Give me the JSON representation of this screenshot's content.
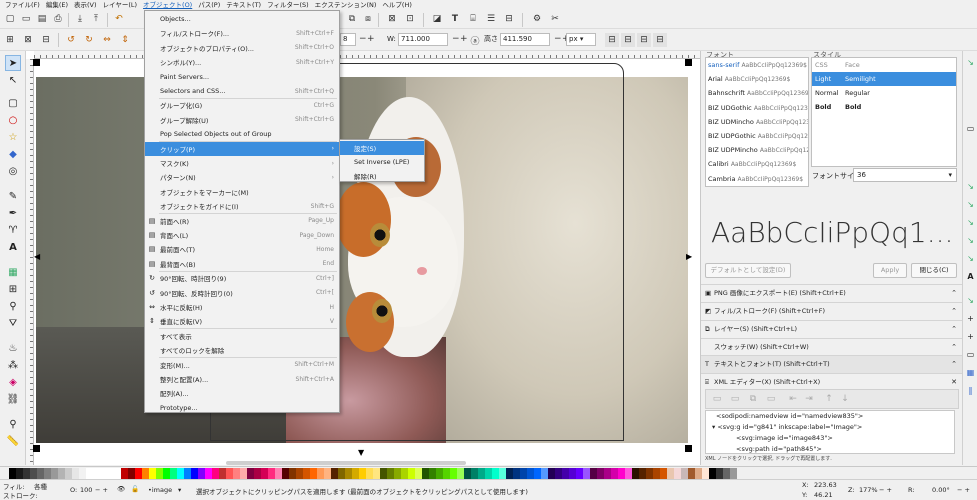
{
  "menubar": [
    "ファイル(F)",
    "編集(E)",
    "表示(V)",
    "レイヤー(L)",
    "オブジェクト(O)",
    "パス(P)",
    "テキスト(T)",
    "フィルター(S)",
    "エクステンション(N)",
    "ヘルプ(H)"
  ],
  "active_menu_index": 4,
  "controls": {
    "x_value": "8",
    "w_label": "W:",
    "w_value": "711.000",
    "h_label": "高さ",
    "h_value": "411.590",
    "unit": "px"
  },
  "object_menu": [
    {
      "label": "Objects...",
      "shortcut": "",
      "icon": ""
    },
    {
      "label": "フィル/ストローク(F)...",
      "shortcut": "Shift+Ctrl+F",
      "icon": ""
    },
    {
      "label": "オブジェクトのプロパティ(O)...",
      "shortcut": "Shift+Ctrl+O",
      "icon": ""
    },
    {
      "label": "シンボル(Y)...",
      "shortcut": "Shift+Ctrl+Y",
      "icon": ""
    },
    {
      "label": "Paint Servers...",
      "shortcut": "",
      "icon": ""
    },
    {
      "label": "Selectors and CSS...",
      "shortcut": "Shift+Ctrl+Q",
      "icon": ""
    },
    {
      "label": "グループ化(G)",
      "shortcut": "Ctrl+G",
      "icon": ""
    },
    {
      "label": "グループ解除(U)",
      "shortcut": "Shift+Ctrl+G",
      "icon": ""
    },
    {
      "label": "Pop Selected Objects out of Group",
      "shortcut": "",
      "icon": ""
    },
    {
      "label": "クリップ(P)",
      "shortcut": "›",
      "icon": ""
    },
    {
      "label": "マスク(K)",
      "shortcut": "›",
      "icon": ""
    },
    {
      "label": "パターン(N)",
      "shortcut": "›",
      "icon": ""
    },
    {
      "label": "オブジェクトをマーカーに(M)",
      "shortcut": "",
      "icon": ""
    },
    {
      "label": "オブジェクトをガイドに(I)",
      "shortcut": "Shift+G",
      "icon": ""
    },
    {
      "label": "前面へ(R)",
      "shortcut": "Page_Up",
      "icon": "▤"
    },
    {
      "label": "背面へ(L)",
      "shortcut": "Page_Down",
      "icon": "▤"
    },
    {
      "label": "最前面へ(T)",
      "shortcut": "Home",
      "icon": "▤"
    },
    {
      "label": "最背面へ(B)",
      "shortcut": "End",
      "icon": "▤"
    },
    {
      "label": "90°回転、時計回り(9)",
      "shortcut": "Ctrl+]",
      "icon": "↻"
    },
    {
      "label": "90°回転、反時計回り(0)",
      "shortcut": "Ctrl+[",
      "icon": "↺"
    },
    {
      "label": "水平に反転(H)",
      "shortcut": "H",
      "icon": "⇔"
    },
    {
      "label": "垂直に反転(V)",
      "shortcut": "V",
      "icon": "⇕"
    },
    {
      "label": "すべて表示",
      "shortcut": "",
      "icon": ""
    },
    {
      "label": "すべてのロックを解除",
      "shortcut": "",
      "icon": ""
    },
    {
      "label": "変形(M)...",
      "shortcut": "Shift+Ctrl+M",
      "icon": ""
    },
    {
      "label": "整列と配置(A)...",
      "shortcut": "Shift+Ctrl+A",
      "icon": ""
    },
    {
      "label": "配列(A)...",
      "shortcut": "",
      "icon": ""
    },
    {
      "label": "Prototype...",
      "shortcut": "",
      "icon": ""
    }
  ],
  "highlighted_menu_index": 9,
  "clip_submenu": [
    {
      "label": "設定(S)"
    },
    {
      "label": "Set Inverse (LPE)"
    },
    {
      "label": "解除(R)"
    }
  ],
  "highlighted_submenu_index": 0,
  "font_panel": {
    "font_label": "フォント",
    "style_label": "スタイル",
    "sample": "AaBbCcIiPpQq12369$",
    "fonts": [
      {
        "name": "sans-serif",
        "selected": true
      },
      {
        "name": "Arial",
        "selected": false
      },
      {
        "name": "Bahnschrift",
        "selected": false
      },
      {
        "name": "BIZ UDGothic",
        "selected": false
      },
      {
        "name": "BIZ UDMincho",
        "selected": false
      },
      {
        "name": "BIZ UDPGothic",
        "selected": false
      },
      {
        "name": "BIZ UDPMincho",
        "selected": false
      },
      {
        "name": "Calibri",
        "selected": false
      },
      {
        "name": "Cambria",
        "selected": false
      }
    ],
    "styles": [
      {
        "c1": "CSS",
        "c2": "Face",
        "kind": "head"
      },
      {
        "c1": "Light",
        "c2": "Semilight",
        "kind": "sel"
      },
      {
        "c1": "Normal",
        "c2": "Regular",
        "kind": ""
      },
      {
        "c1": "Bold",
        "c2": "Bold",
        "kind": "bold"
      }
    ],
    "size_label": "フォントサイズ",
    "size_value": "36",
    "preview": "AaBbCcIiPpQq1...",
    "default_btn": "デフォルトとして設定(D)",
    "apply_btn": "Apply",
    "close_btn": "閉じる(C)"
  },
  "docks": [
    {
      "label": "PNG 画像にエクスポート(E) (Shift+Ctrl+E)",
      "icon": "▣"
    },
    {
      "label": "フィル/ストローク(F) (Shift+Ctrl+F)",
      "icon": "◩"
    },
    {
      "label": "レイヤー(S) (Shift+Ctrl+L)",
      "icon": "⧉"
    },
    {
      "label": "スウォッチ(W) (Shift+Ctrl+W)",
      "icon": ""
    },
    {
      "label": "テキストとフォント(T) (Shift+Ctrl+T)",
      "icon": "T"
    },
    {
      "label": "XML エディター(X) (Shift+Ctrl+X)",
      "icon": "⌸"
    }
  ],
  "xml_nodes": [
    "<sodipodi:namedview id=\"namedview835\">",
    "▾ <svg:g id=\"g841\" inkscape:label=\"Image\">",
    "<svg:image id=\"image843\">",
    "<svg:path id=\"path845\">"
  ],
  "xml_hint": "XML ノードをクリックで選択, ドラッグで再配置します.",
  "status": {
    "fill_label": "フィル:",
    "fill_value": "各種",
    "stroke_label": "ストローク:",
    "opacity_label": "O:",
    "opacity_value": "100",
    "layer": "•image",
    "message": "選択オブジェクトにクリッピングパスを適用します (最前面のオブジェクトをクリッピングパスとして使用します)",
    "x_label": "X:",
    "x_value": "223.63",
    "y_label": "Y:",
    "y_value": "46.21",
    "zoom_label": "Z:",
    "zoom_value": "177%",
    "rot_label": "R:",
    "rot_value": "0.00°"
  },
  "palette_colors": [
    "#000000",
    "#1a1a1a",
    "#333333",
    "#4d4d4d",
    "#666666",
    "#808080",
    "#999999",
    "#b3b3b3",
    "#cccccc",
    "#e6e6e6",
    "#f2f2f2",
    "#ffffff",
    "#ffffff",
    "#ffffff",
    "#ffffff",
    "#ffffff",
    "#c00000",
    "#800000",
    "#ff0000",
    "#ff8000",
    "#ffff00",
    "#80ff00",
    "#00ff00",
    "#00ff80",
    "#00ffff",
    "#0080ff",
    "#0000ff",
    "#8000ff",
    "#ff00ff",
    "#ff0080",
    "#c03030",
    "#ff5555",
    "#ff8080",
    "#ffaaaa",
    "#800040",
    "#aa0044",
    "#d40055",
    "#ff2a7f",
    "#ff80b2",
    "#550000",
    "#803300",
    "#aa4400",
    "#d45500",
    "#ff6600",
    "#ff9955",
    "#ffb380",
    "#552200",
    "#806600",
    "#aa8800",
    "#d4aa00",
    "#ffcc00",
    "#ffdd55",
    "#ffe680",
    "#445500",
    "#668000",
    "#88aa00",
    "#aad400",
    "#ccff00",
    "#ddff55",
    "#225500",
    "#338000",
    "#44aa00",
    "#55d400",
    "#66ff00",
    "#99ff55",
    "#005544",
    "#008066",
    "#00aa88",
    "#00d4aa",
    "#00ffcc",
    "#55ffdd",
    "#002255",
    "#003380",
    "#0044aa",
    "#0055d4",
    "#0066ff",
    "#5599ff",
    "#220055",
    "#330080",
    "#4400aa",
    "#5500d4",
    "#6600ff",
    "#9955ff",
    "#550044",
    "#800066",
    "#aa0088",
    "#d400aa",
    "#ff00cc",
    "#ff55dd",
    "#2b1100",
    "#552200",
    "#7f3300",
    "#aa4400",
    "#d45500",
    "#e9c6af",
    "#f4d7d7",
    "#c8b7b7",
    "#a05a2c",
    "#deaa87",
    "#ffe6d5",
    "#000000",
    "#333333",
    "#666666",
    "#999999"
  ]
}
